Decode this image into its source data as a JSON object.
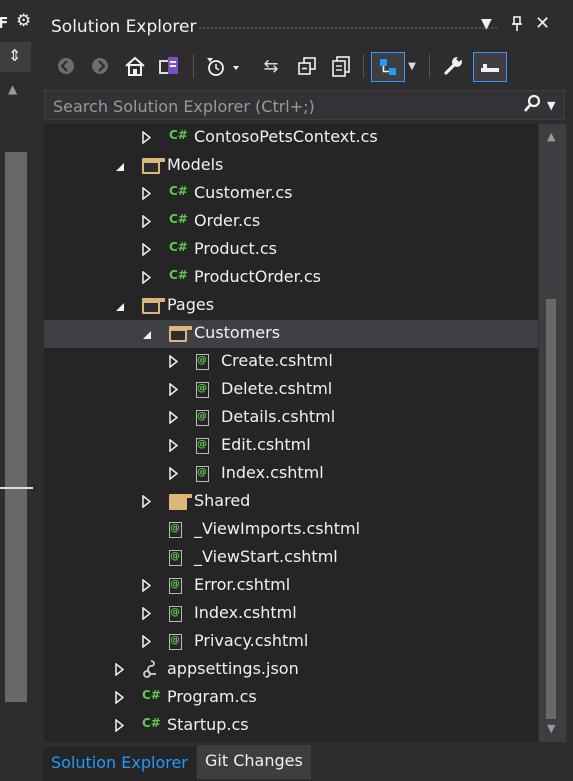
{
  "panel": {
    "title": "Solution Explorer",
    "title_dropdown_icon": "chevron-down-icon",
    "pin_icon": "pin-icon",
    "close_icon": "close-icon"
  },
  "toolbar": {
    "buttons": [
      {
        "name": "back-icon"
      },
      {
        "name": "forward-icon"
      },
      {
        "name": "home-icon"
      },
      {
        "name": "switch-views-icon"
      },
      {
        "name": "pending-changes-filter-icon"
      },
      {
        "name": "sync-with-active-document-icon"
      },
      {
        "name": "collapse-all-icon"
      },
      {
        "name": "show-all-files-icon"
      },
      {
        "name": "preview-selected-items-icon"
      },
      {
        "name": "properties-icon"
      },
      {
        "name": "auto-hide-icon"
      }
    ]
  },
  "search": {
    "placeholder": "Search Solution Explorer (Ctrl+;)",
    "icon": "search-icon"
  },
  "tree": {
    "items": [
      {
        "label": "ContosoPetsContext.cs",
        "type": "cs",
        "expander": "collapsed"
      },
      {
        "label": "Models",
        "type": "folder-open",
        "expander": "expanded"
      },
      {
        "label": "Customer.cs",
        "type": "cs",
        "expander": "collapsed"
      },
      {
        "label": "Order.cs",
        "type": "cs",
        "expander": "collapsed"
      },
      {
        "label": "Product.cs",
        "type": "cs",
        "expander": "collapsed"
      },
      {
        "label": "ProductOrder.cs",
        "type": "cs",
        "expander": "collapsed"
      },
      {
        "label": "Pages",
        "type": "folder-open",
        "expander": "expanded"
      },
      {
        "label": "Customers",
        "type": "folder-open",
        "expander": "expanded",
        "selected": true
      },
      {
        "label": "Create.cshtml",
        "type": "razor",
        "expander": "collapsed"
      },
      {
        "label": "Delete.cshtml",
        "type": "razor",
        "expander": "collapsed"
      },
      {
        "label": "Details.cshtml",
        "type": "razor",
        "expander": "collapsed"
      },
      {
        "label": "Edit.cshtml",
        "type": "razor",
        "expander": "collapsed"
      },
      {
        "label": "Index.cshtml",
        "type": "razor",
        "expander": "collapsed"
      },
      {
        "label": "Shared",
        "type": "folder",
        "expander": "collapsed"
      },
      {
        "label": "_ViewImports.cshtml",
        "type": "razor",
        "expander": "none"
      },
      {
        "label": "_ViewStart.cshtml",
        "type": "razor",
        "expander": "none"
      },
      {
        "label": "Error.cshtml",
        "type": "razor",
        "expander": "collapsed"
      },
      {
        "label": "Index.cshtml",
        "type": "razor",
        "expander": "collapsed"
      },
      {
        "label": "Privacy.cshtml",
        "type": "razor",
        "expander": "collapsed"
      },
      {
        "label": "appsettings.json",
        "type": "json",
        "expander": "collapsed"
      },
      {
        "label": "Program.cs",
        "type": "cs",
        "expander": "collapsed"
      },
      {
        "label": "Startup.cs",
        "type": "cs",
        "expander": "collapsed"
      }
    ]
  },
  "tabs": {
    "solution_explorer": "Solution Explorer",
    "git_changes": "Git Changes"
  },
  "colors": {
    "background": "#2d2d30",
    "tree_background": "#252526",
    "selection": "#3f3f46",
    "accent": "#1e9bff",
    "csharp_green": "#5fc94e",
    "folder": "#dcb67a"
  }
}
